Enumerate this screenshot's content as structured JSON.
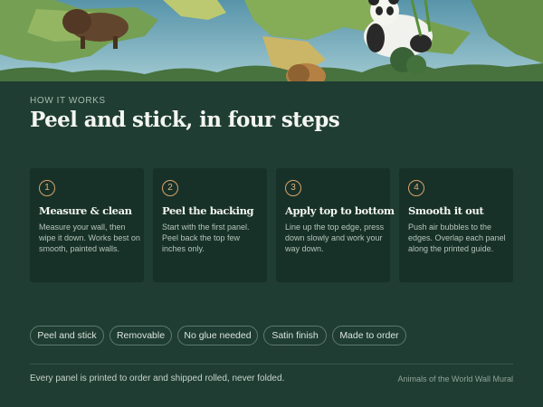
{
  "hero": {
    "image_alt": "Illustrated world map with bison, panda, lion and other animals"
  },
  "section": {
    "eyebrow": "HOW IT WORKS",
    "title": "Peel and stick, in four steps"
  },
  "steps": [
    {
      "number": "1",
      "title": "Measure & clean",
      "description": "Measure your wall, then wipe it down. Works best on smooth, painted walls."
    },
    {
      "number": "2",
      "title": "Peel the backing",
      "description": "Start with the first panel. Peel back the top few inches only."
    },
    {
      "number": "3",
      "title": "Apply top to bottom",
      "description": "Line up the top edge, press down slowly and work your way down."
    },
    {
      "number": "4",
      "title": "Smooth it out",
      "description": "Push air bubbles to the edges. Overlap each panel along the printed guide."
    }
  ],
  "tags": [
    "Peel and stick",
    "Removable",
    "No glue needed",
    "Satin finish",
    "Made to order"
  ],
  "footer": {
    "note": "Every panel is printed to order and shipped rolled, never folded.",
    "product": "Animals of the World Wall Mural"
  },
  "colors": {
    "background": "#1f3d33",
    "card": "#173128",
    "accent": "#d9a36d",
    "tag_border": "#5f7a6d"
  }
}
